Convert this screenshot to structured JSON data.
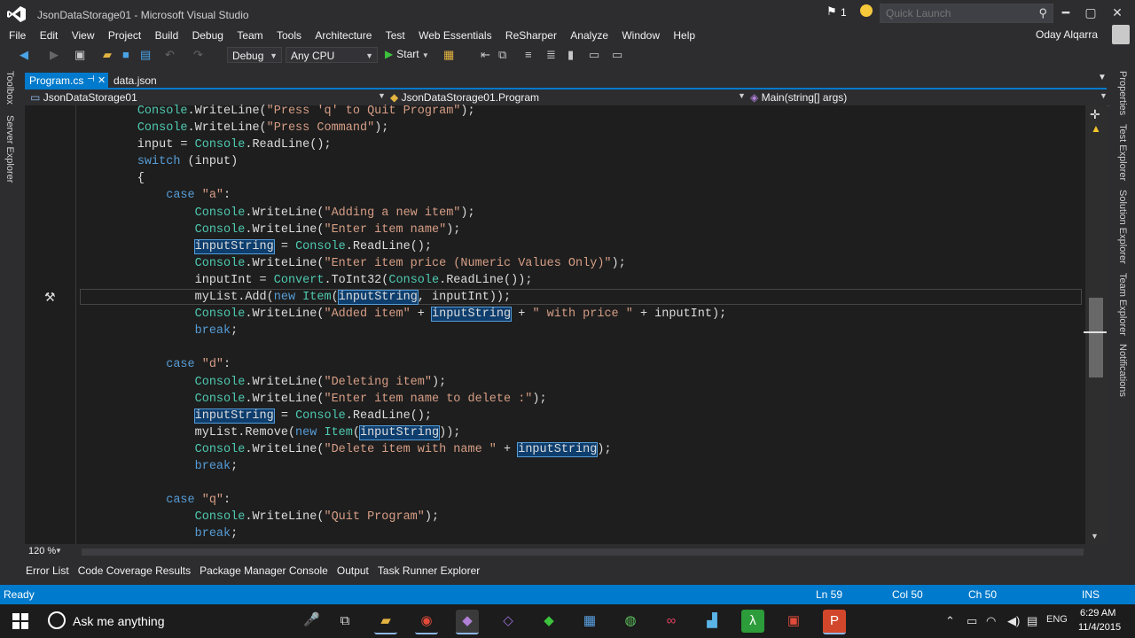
{
  "window": {
    "title": "JsonDataStorage01 - Microsoft Visual Studio",
    "notification_count": "1",
    "quick_launch_placeholder": "Quick Launch",
    "user_name": "Oday Alqarra"
  },
  "menu": [
    "File",
    "Edit",
    "View",
    "Project",
    "Build",
    "Debug",
    "Team",
    "Tools",
    "Architecture",
    "Test",
    "Web Essentials",
    "ReSharper",
    "Analyze",
    "Window",
    "Help"
  ],
  "toolbar": {
    "configuration": "Debug",
    "platform": "Any CPU",
    "start_label": "Start"
  },
  "side_panels": {
    "left": [
      "Toolbox",
      "Server Explorer"
    ],
    "right": [
      "Properties",
      "Test Explorer",
      "Solution Explorer",
      "Team Explorer",
      "Notifications"
    ]
  },
  "tabs": {
    "active": "Program.cs",
    "other": "data.json"
  },
  "navbar": {
    "project": "JsonDataStorage01",
    "class": "JsonDataStorage01.Program",
    "member": "Main(string[] args)"
  },
  "editor": {
    "zoom": "120 %"
  },
  "bottom_tabs": [
    "Error List",
    "Code Coverage Results",
    "Package Manager Console",
    "Output",
    "Task Runner Explorer"
  ],
  "status": {
    "state": "Ready",
    "line": "Ln 59",
    "col": "Col 50",
    "ch": "Ch 50",
    "mode": "INS"
  },
  "taskbar": {
    "search_placeholder": "Ask me anything",
    "language": "ENG",
    "time": "6:29 AM",
    "date": "11/4/2015"
  },
  "colors": {
    "accent": "#007acc",
    "editor_bg": "#1e1e1e",
    "keyword": "#569cd6",
    "type": "#4ec9b0",
    "string": "#d69d85"
  }
}
